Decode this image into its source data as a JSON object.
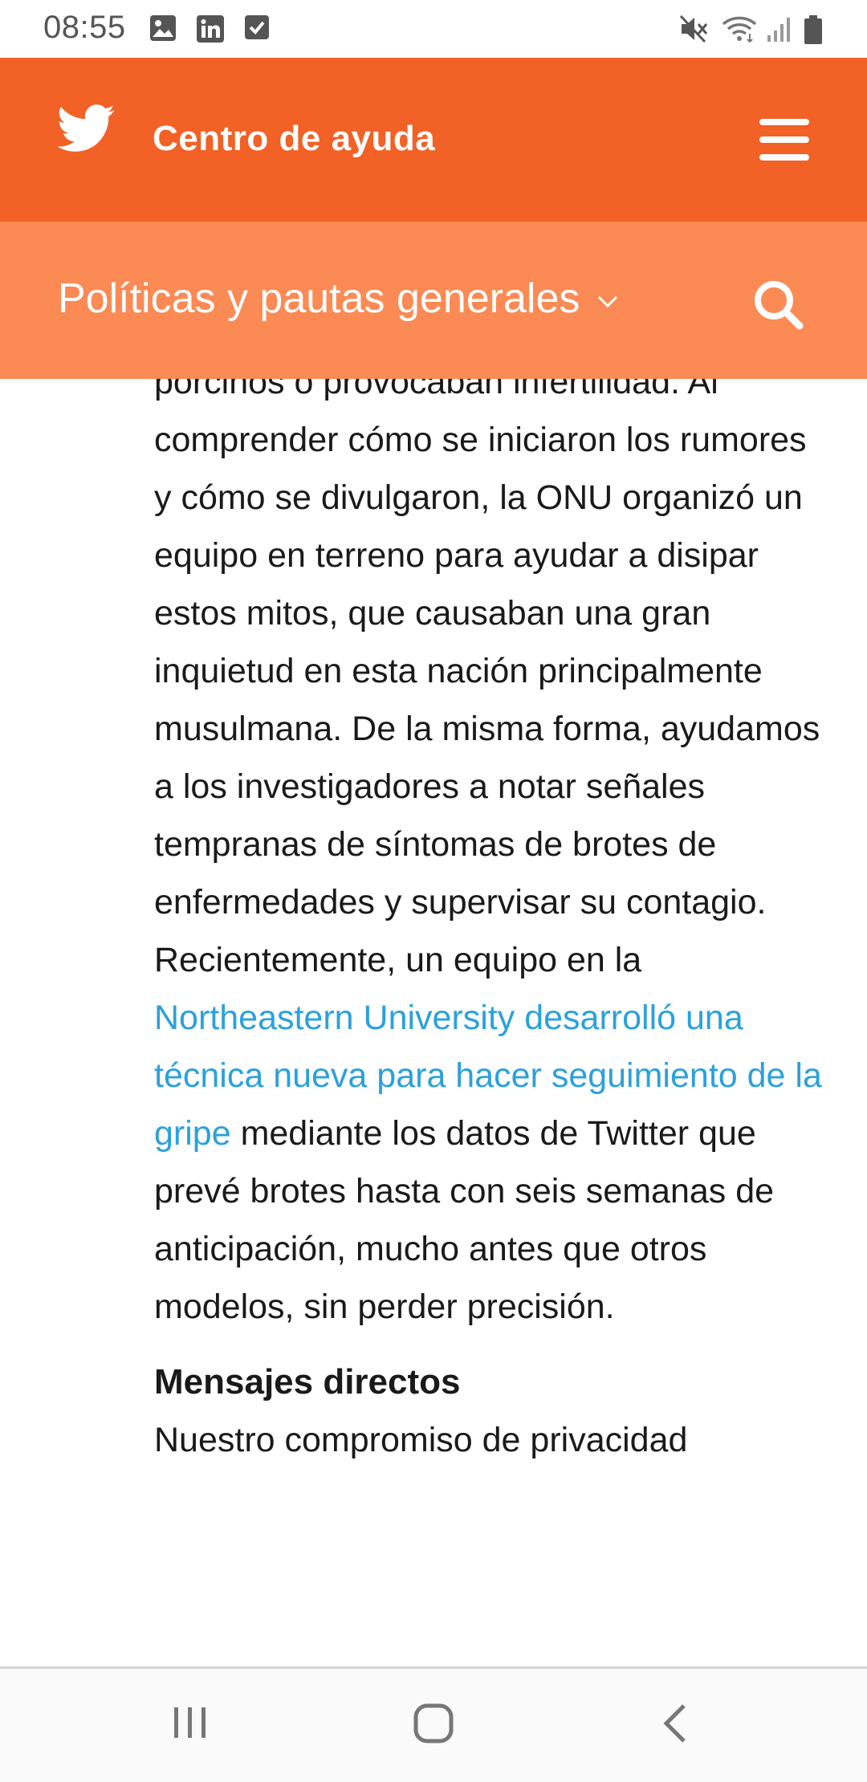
{
  "status_bar": {
    "time": "08:55",
    "left_icons": [
      "image-icon",
      "linkedin-icon",
      "checkbox-icon"
    ],
    "right_icons": [
      "mute-icon",
      "wifi-icon",
      "signal-icon",
      "battery-icon"
    ]
  },
  "header": {
    "logo_icon": "twitter-bird-icon",
    "title": "Centro de ayuda",
    "menu_icon": "hamburger-menu-icon",
    "color": "#f26125"
  },
  "subheader": {
    "section": "Políticas y pautas generales",
    "dropdown_icon": "chevron-down-icon",
    "search_icon": "search-icon",
    "color": "#fb8a54"
  },
  "article": {
    "clipped_top_line": "porcinos o provocaban infertilidad.",
    "text_before_link": "Al comprender cómo se iniciaron los rumores y cómo se divulgaron, la ONU organizó un equipo en terreno para ayudar a disipar estos mitos, que causaban una gran inquietud en esta nación principalmente musulmana. De la misma forma, ayudamos a los investigadores a notar señales tempranas de síntomas de brotes de enfermedades y supervisar su contagio. Recientemente, un equipo en la ",
    "link_text": "Northeastern University desarrolló una técnica nueva para hacer seguimiento de la gripe",
    "text_after_link": " mediante los datos de Twitter que prevé brotes hasta con seis semanas de anticipación, mucho antes que otros modelos, sin perder precisión.",
    "heading": "Mensajes directos",
    "clipped_bottom_line": "Nuestro compromiso de privacidad",
    "link_color": "#2ba1dc"
  },
  "nav_bar": {
    "buttons": [
      "recent-apps-icon",
      "home-icon",
      "back-icon"
    ]
  }
}
